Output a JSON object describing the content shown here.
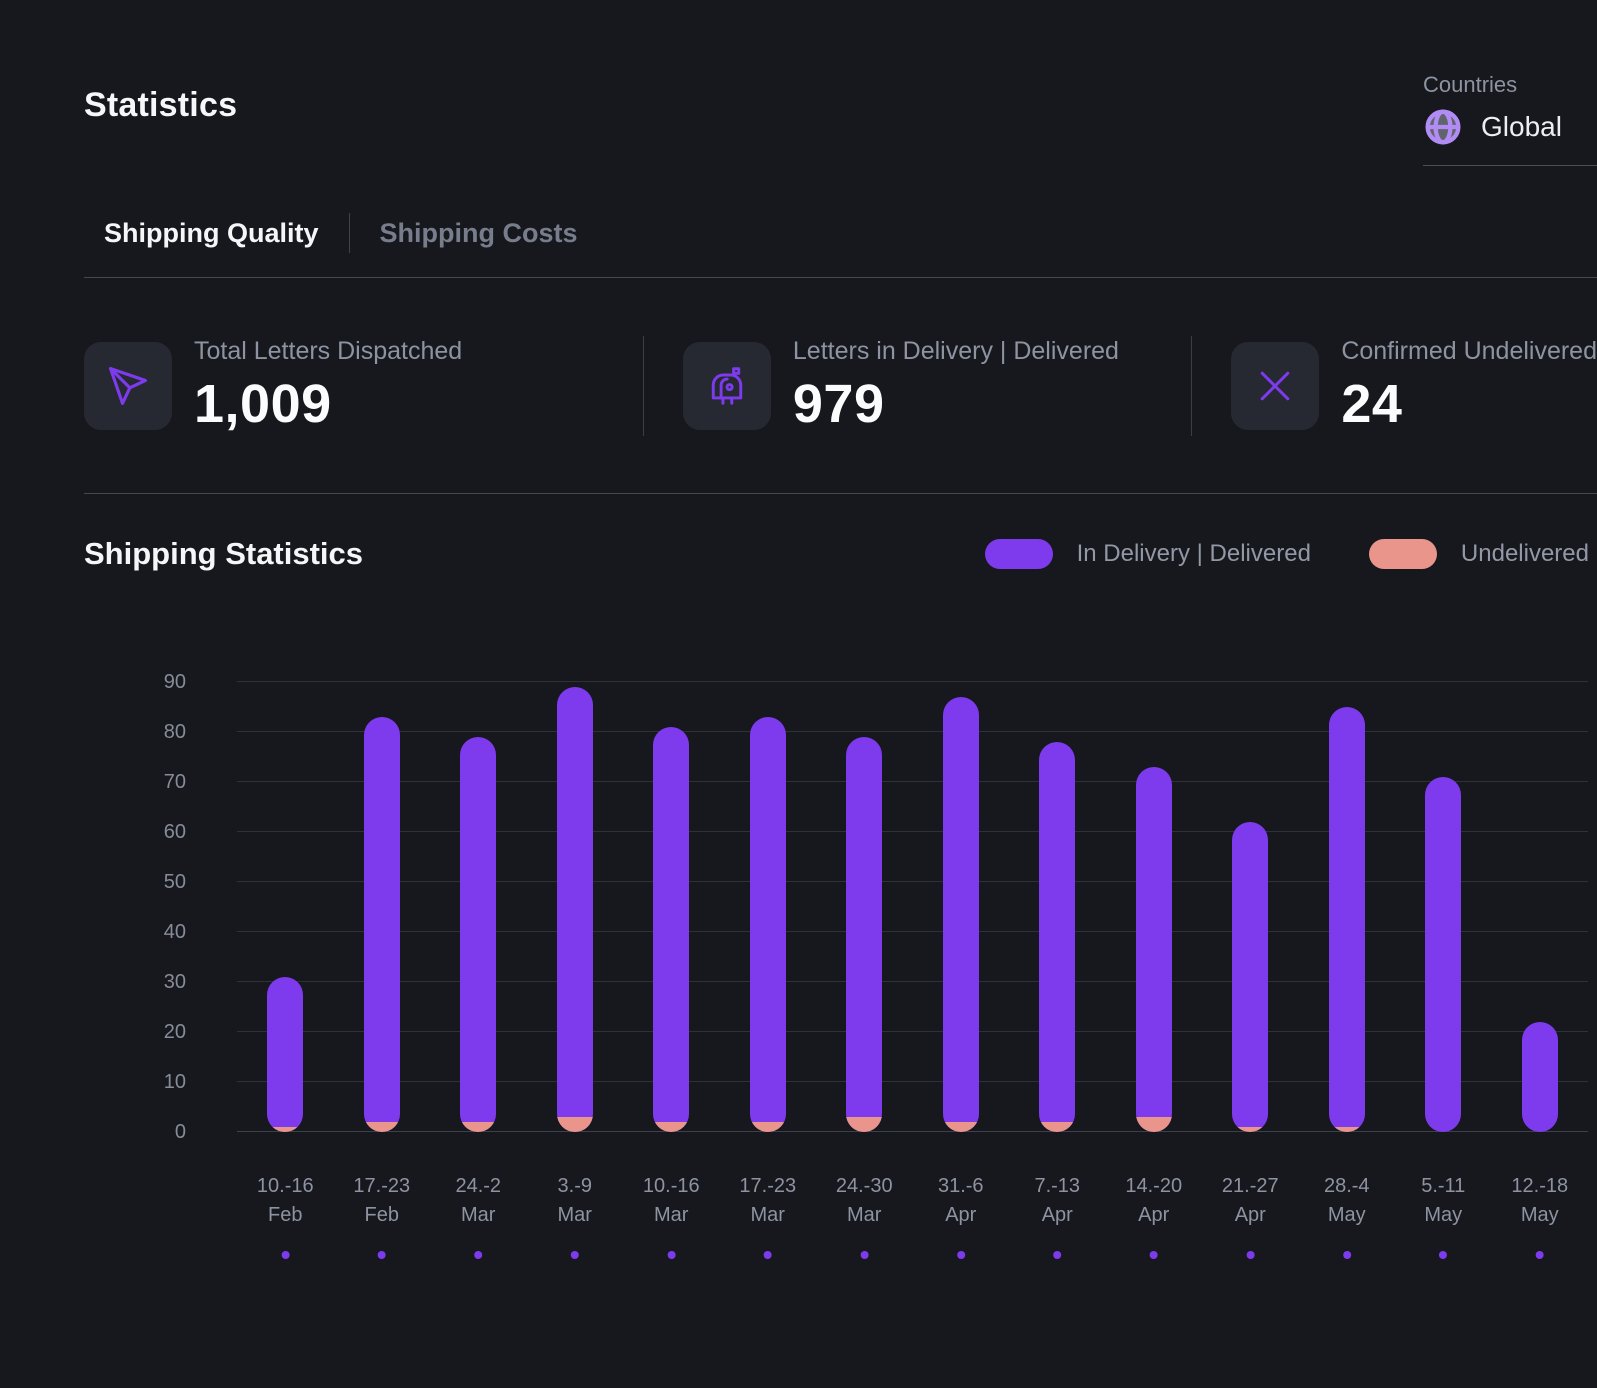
{
  "page": {
    "title": "Statistics"
  },
  "countries": {
    "label": "Countries",
    "value": "Global"
  },
  "tabs": [
    {
      "label": "Shipping Quality",
      "active": true
    },
    {
      "label": "Shipping Costs",
      "active": false
    }
  ],
  "stats": [
    {
      "icon": "send-icon",
      "label": "Total Letters Dispatched",
      "value": "1,009"
    },
    {
      "icon": "mailbox-icon",
      "label": "Letters in Delivery | Delivered",
      "value": "979"
    },
    {
      "icon": "x-icon",
      "label": "Confirmed Undelivered",
      "value": "24"
    }
  ],
  "section": {
    "title": "Shipping Statistics"
  },
  "legend": [
    {
      "label": "In Delivery | Delivered",
      "color": "#7e3bee"
    },
    {
      "label": "Undelivered",
      "color": "#e9958b"
    }
  ],
  "colors": {
    "background": "#16181e",
    "accent_purple": "#7e3bee",
    "accent_salmon": "#e9958b",
    "muted_text": "#8d93a0"
  },
  "chart_data": {
    "type": "bar",
    "stacked": true,
    "title": "Shipping Statistics",
    "legend_position": "top-right",
    "grid": "horizontal",
    "ylim": [
      0,
      90
    ],
    "yticks": [
      0,
      10,
      20,
      30,
      40,
      50,
      60,
      70,
      80,
      90
    ],
    "categories": [
      {
        "week": "10.-16",
        "month": "Feb"
      },
      {
        "week": "17.-23",
        "month": "Feb"
      },
      {
        "week": "24.-2",
        "month": "Mar"
      },
      {
        "week": "3.-9",
        "month": "Mar"
      },
      {
        "week": "10.-16",
        "month": "Mar"
      },
      {
        "week": "17.-23",
        "month": "Mar"
      },
      {
        "week": "24.-30",
        "month": "Mar"
      },
      {
        "week": "31.-6",
        "month": "Apr"
      },
      {
        "week": "7.-13",
        "month": "Apr"
      },
      {
        "week": "14.-20",
        "month": "Apr"
      },
      {
        "week": "21.-27",
        "month": "Apr"
      },
      {
        "week": "28.-4",
        "month": "May"
      },
      {
        "week": "5.-11",
        "month": "May"
      },
      {
        "week": "12.-18",
        "month": "May"
      }
    ],
    "series": [
      {
        "name": "In Delivery | Delivered",
        "color": "#7e3bee",
        "values": [
          30,
          81,
          77,
          86,
          79,
          81,
          76,
          85,
          76,
          70,
          61,
          84,
          71,
          22
        ]
      },
      {
        "name": "Undelivered",
        "color": "#e9958b",
        "values": [
          1,
          2,
          2,
          3,
          2,
          2,
          3,
          2,
          2,
          3,
          1,
          1,
          0,
          0
        ]
      }
    ]
  }
}
